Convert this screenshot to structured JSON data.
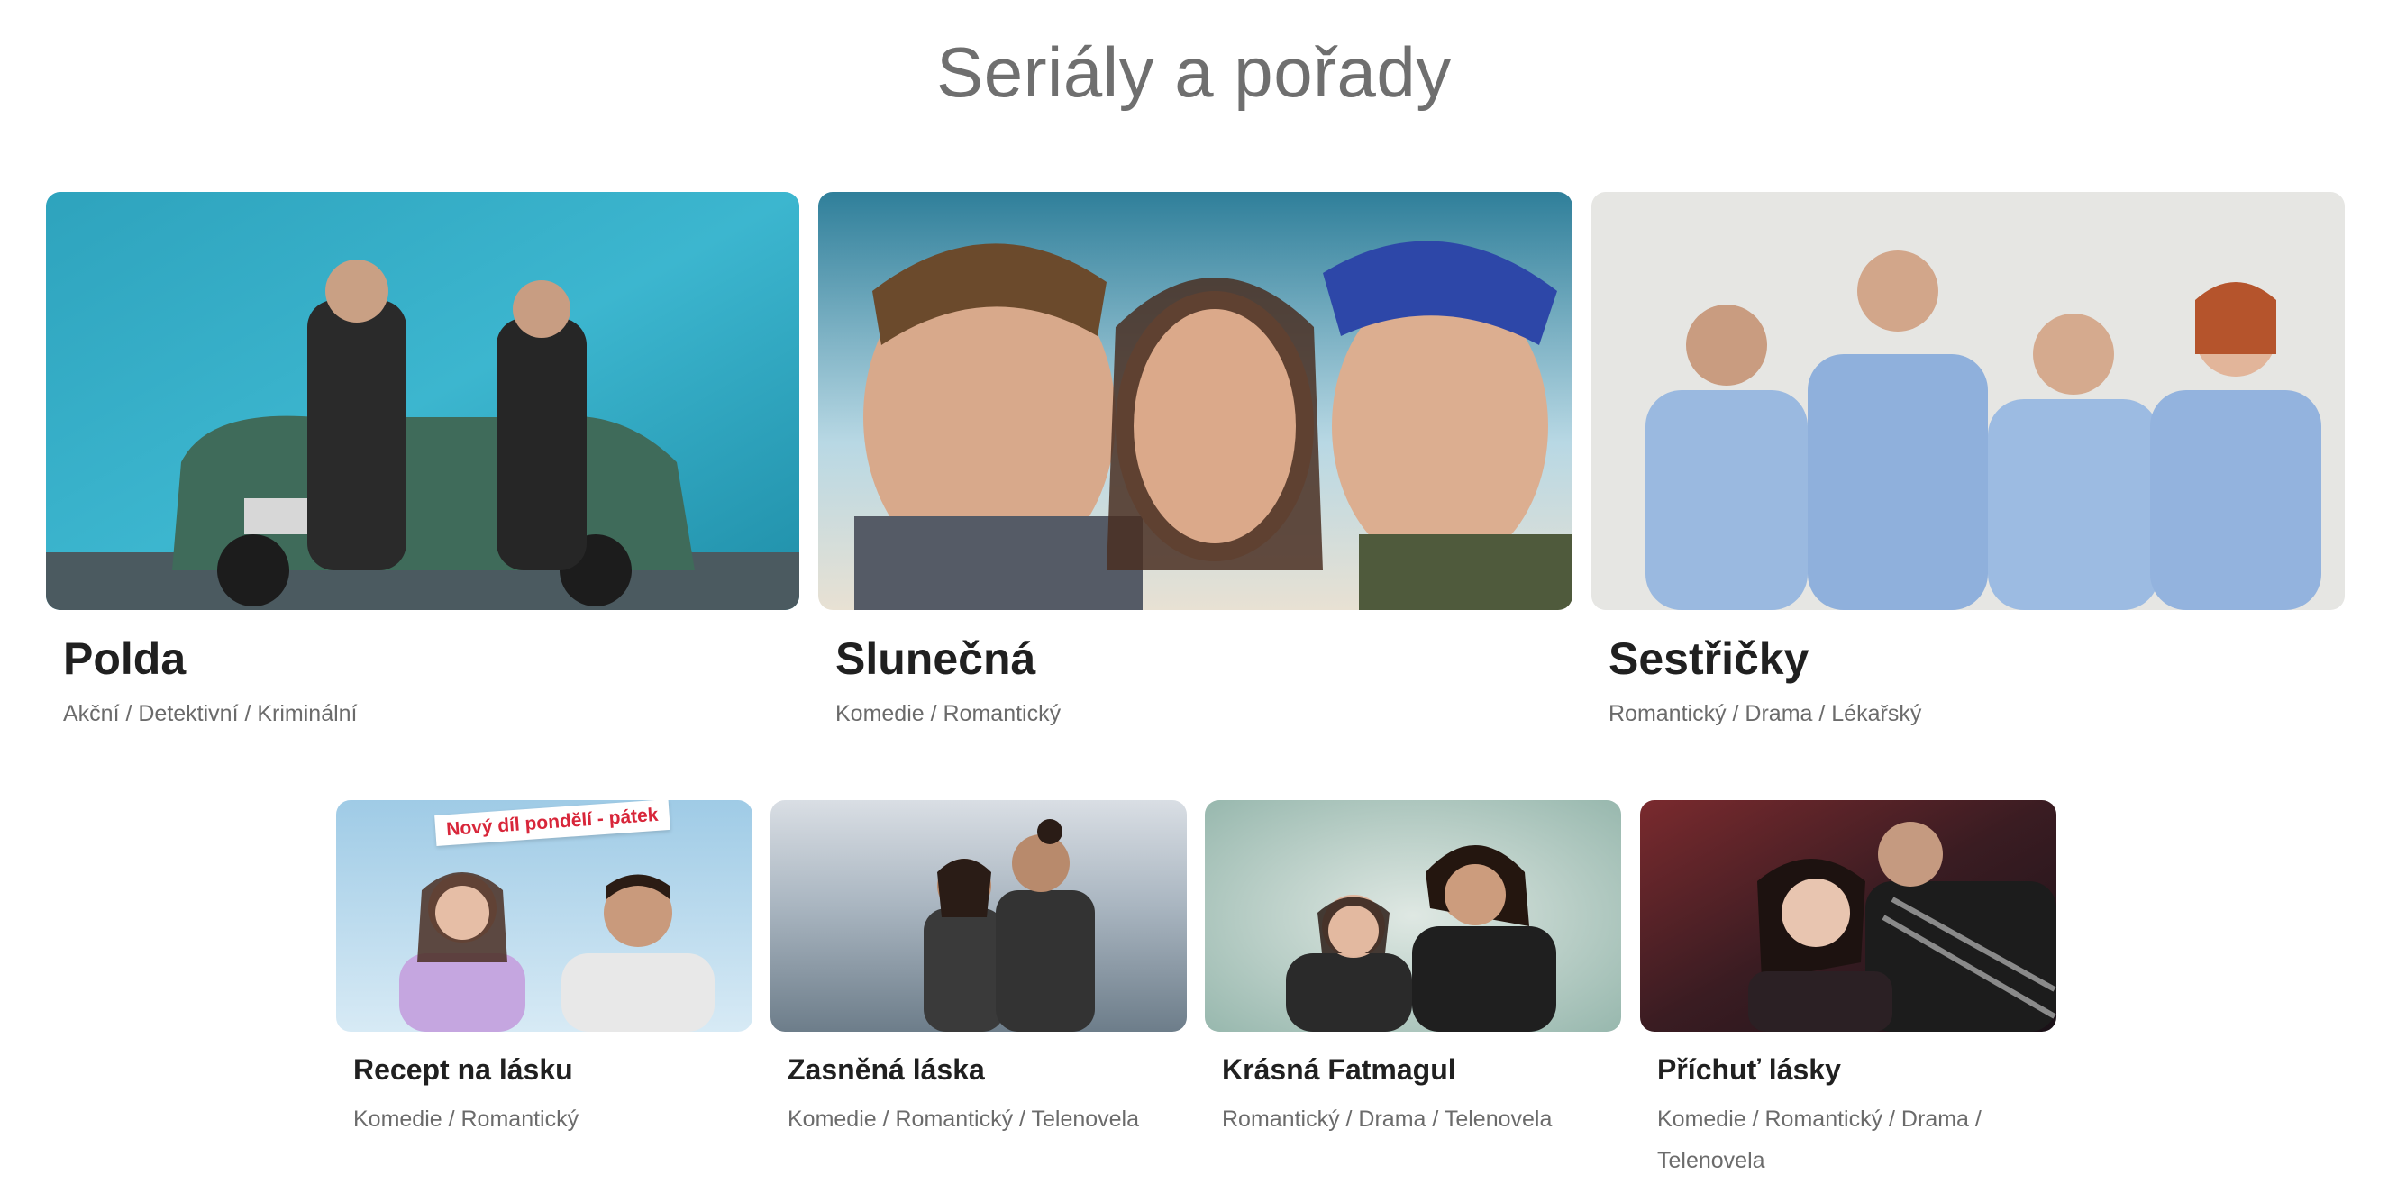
{
  "page": {
    "title": "Seriály a pořady"
  },
  "featured": [
    {
      "title": "Polda",
      "genres": "Akční / Detektivní / Kriminální"
    },
    {
      "title": "Slunečná",
      "genres": "Komedie / Romantický"
    },
    {
      "title": "Sestřičky",
      "genres": "Romantický / Drama / Lékařský"
    }
  ],
  "shows": [
    {
      "title": "Recept na lásku",
      "genres": "Komedie / Romantický",
      "banner": "Nový díl pondělí - pátek"
    },
    {
      "title": "Zasněná láska",
      "genres": "Komedie / Romantický / Telenovela"
    },
    {
      "title": "Krásná Fatmagul",
      "genres": "Romantický / Drama / Telenovela"
    },
    {
      "title": "Příchuť lásky",
      "genres": "Komedie / Romantický / Drama / Telenovela"
    }
  ],
  "colors": {
    "title_gray": "#6f6f6f",
    "genre_gray": "#6b6b6b",
    "banner_red": "#d8263a"
  }
}
